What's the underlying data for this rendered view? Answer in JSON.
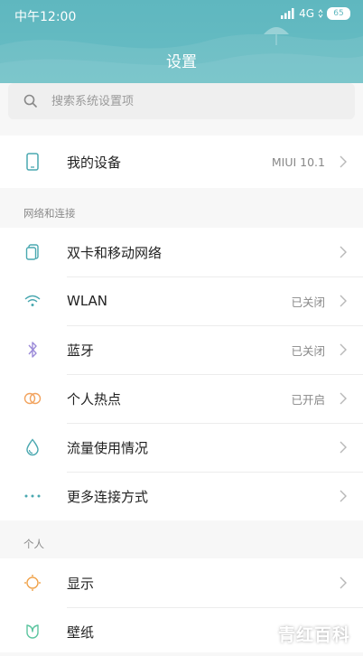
{
  "status_bar": {
    "time": "中午12:00",
    "network": "4G",
    "battery": "65"
  },
  "header": {
    "title": "设置"
  },
  "search": {
    "placeholder": "搜索系统设置项"
  },
  "device": {
    "label": "我的设备",
    "value": "MIUI 10.1"
  },
  "sections": {
    "network": {
      "title": "网络和连接",
      "items": [
        {
          "label": "双卡和移动网络",
          "value": ""
        },
        {
          "label": "WLAN",
          "value": "已关闭"
        },
        {
          "label": "蓝牙",
          "value": "已关闭"
        },
        {
          "label": "个人热点",
          "value": "已开启"
        },
        {
          "label": "流量使用情况",
          "value": ""
        },
        {
          "label": "更多连接方式",
          "value": ""
        }
      ]
    },
    "personal": {
      "title": "个人",
      "items": [
        {
          "label": "显示",
          "value": ""
        },
        {
          "label": "壁纸",
          "value": ""
        }
      ]
    }
  },
  "watermark": "青红百科",
  "colors": {
    "header": "#5fb7bf",
    "accent": "#4aa8b0",
    "bluetooth": "#9b8ad8",
    "hotspot": "#f2a35e",
    "display": "#f0a24a",
    "wallpaper": "#5cc5a0"
  }
}
